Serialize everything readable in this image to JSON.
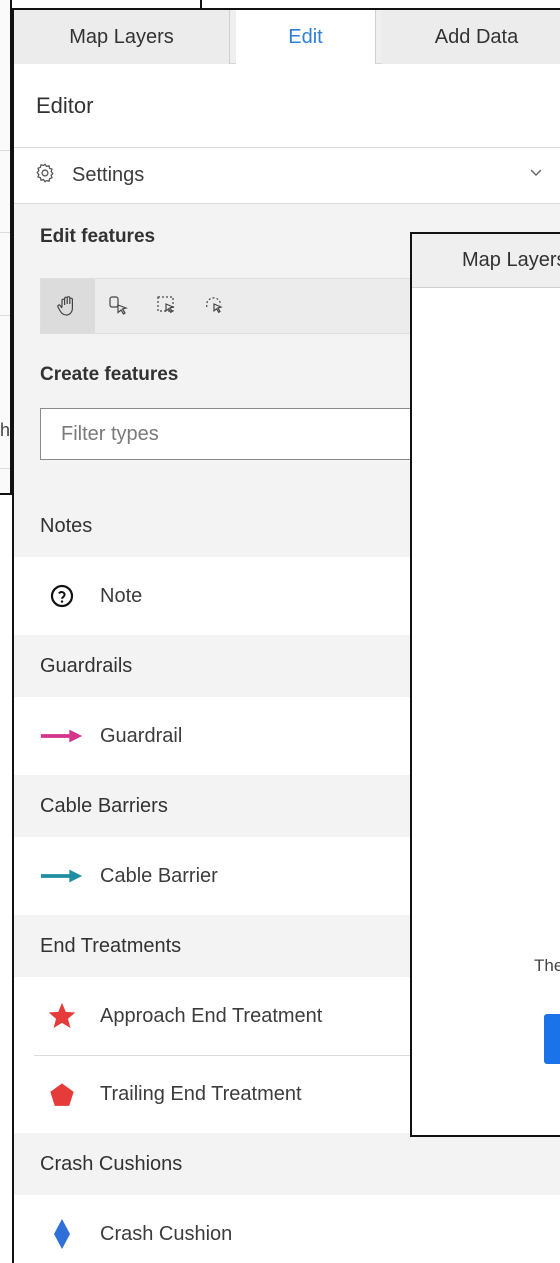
{
  "tabs": [
    {
      "label": "Map Layers",
      "active": false
    },
    {
      "label": "Edit",
      "active": true
    },
    {
      "label": "Add Data",
      "active": false
    }
  ],
  "editor": {
    "title": "Editor"
  },
  "settings": {
    "label": "Settings",
    "icon": "gear-icon",
    "expand_icon": "chevron-down-icon"
  },
  "edit_features": {
    "heading": "Edit features",
    "tools": [
      "pan-hand-icon",
      "select-pointer-icon",
      "rectangle-select-icon",
      "lasso-select-icon"
    ]
  },
  "create_features": {
    "heading": "Create features",
    "filter_placeholder": "Filter types"
  },
  "groups": [
    {
      "name": "Notes",
      "items": [
        {
          "label": "Note",
          "icon": "question-circle-icon"
        }
      ]
    },
    {
      "name": "Guardrails",
      "items": [
        {
          "label": "Guardrail",
          "icon": "arrow-right-icon",
          "color": "#d6338c"
        }
      ]
    },
    {
      "name": "Cable Barriers",
      "items": [
        {
          "label": "Cable Barrier",
          "icon": "arrow-right-icon",
          "color": "#1f8ea0"
        }
      ]
    },
    {
      "name": "End Treatments",
      "items": [
        {
          "label": "Approach End Treatment",
          "icon": "star-icon",
          "color": "#e53b3b"
        },
        {
          "label": "Trailing End Treatment",
          "icon": "pentagon-icon",
          "color": "#e53b3b"
        }
      ]
    },
    {
      "name": "Crash Cushions",
      "items": [
        {
          "label": "Crash Cushion",
          "icon": "diamond-icon",
          "color": "#2e6fd8"
        }
      ]
    }
  ],
  "overlay": {
    "tab_label": "Map Layers",
    "text_fragment": "The",
    "button_color": "#1a73e8"
  },
  "background": {
    "left_fragment": "h"
  }
}
